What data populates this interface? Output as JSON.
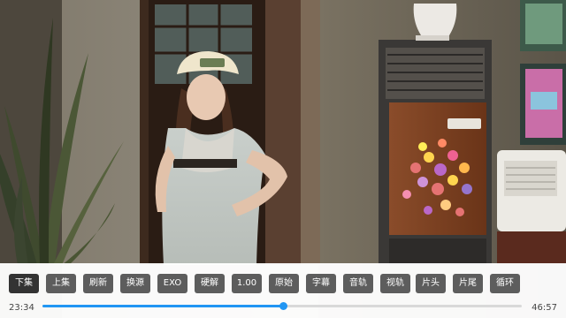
{
  "player": {
    "buttons": [
      {
        "label": "下集",
        "active": true
      },
      {
        "label": "上集"
      },
      {
        "label": "刷新"
      },
      {
        "label": "换源"
      },
      {
        "label": "EXO"
      },
      {
        "label": "硬解"
      },
      {
        "label": "1.00"
      },
      {
        "label": "原始"
      },
      {
        "label": "字幕"
      },
      {
        "label": "音轨"
      },
      {
        "label": "视轨"
      },
      {
        "label": "片头"
      },
      {
        "label": "片尾"
      },
      {
        "label": "循环"
      }
    ],
    "elapsed": "23:34",
    "total": "46:57",
    "progress": 0.502,
    "accent_color": "#2196f3"
  }
}
